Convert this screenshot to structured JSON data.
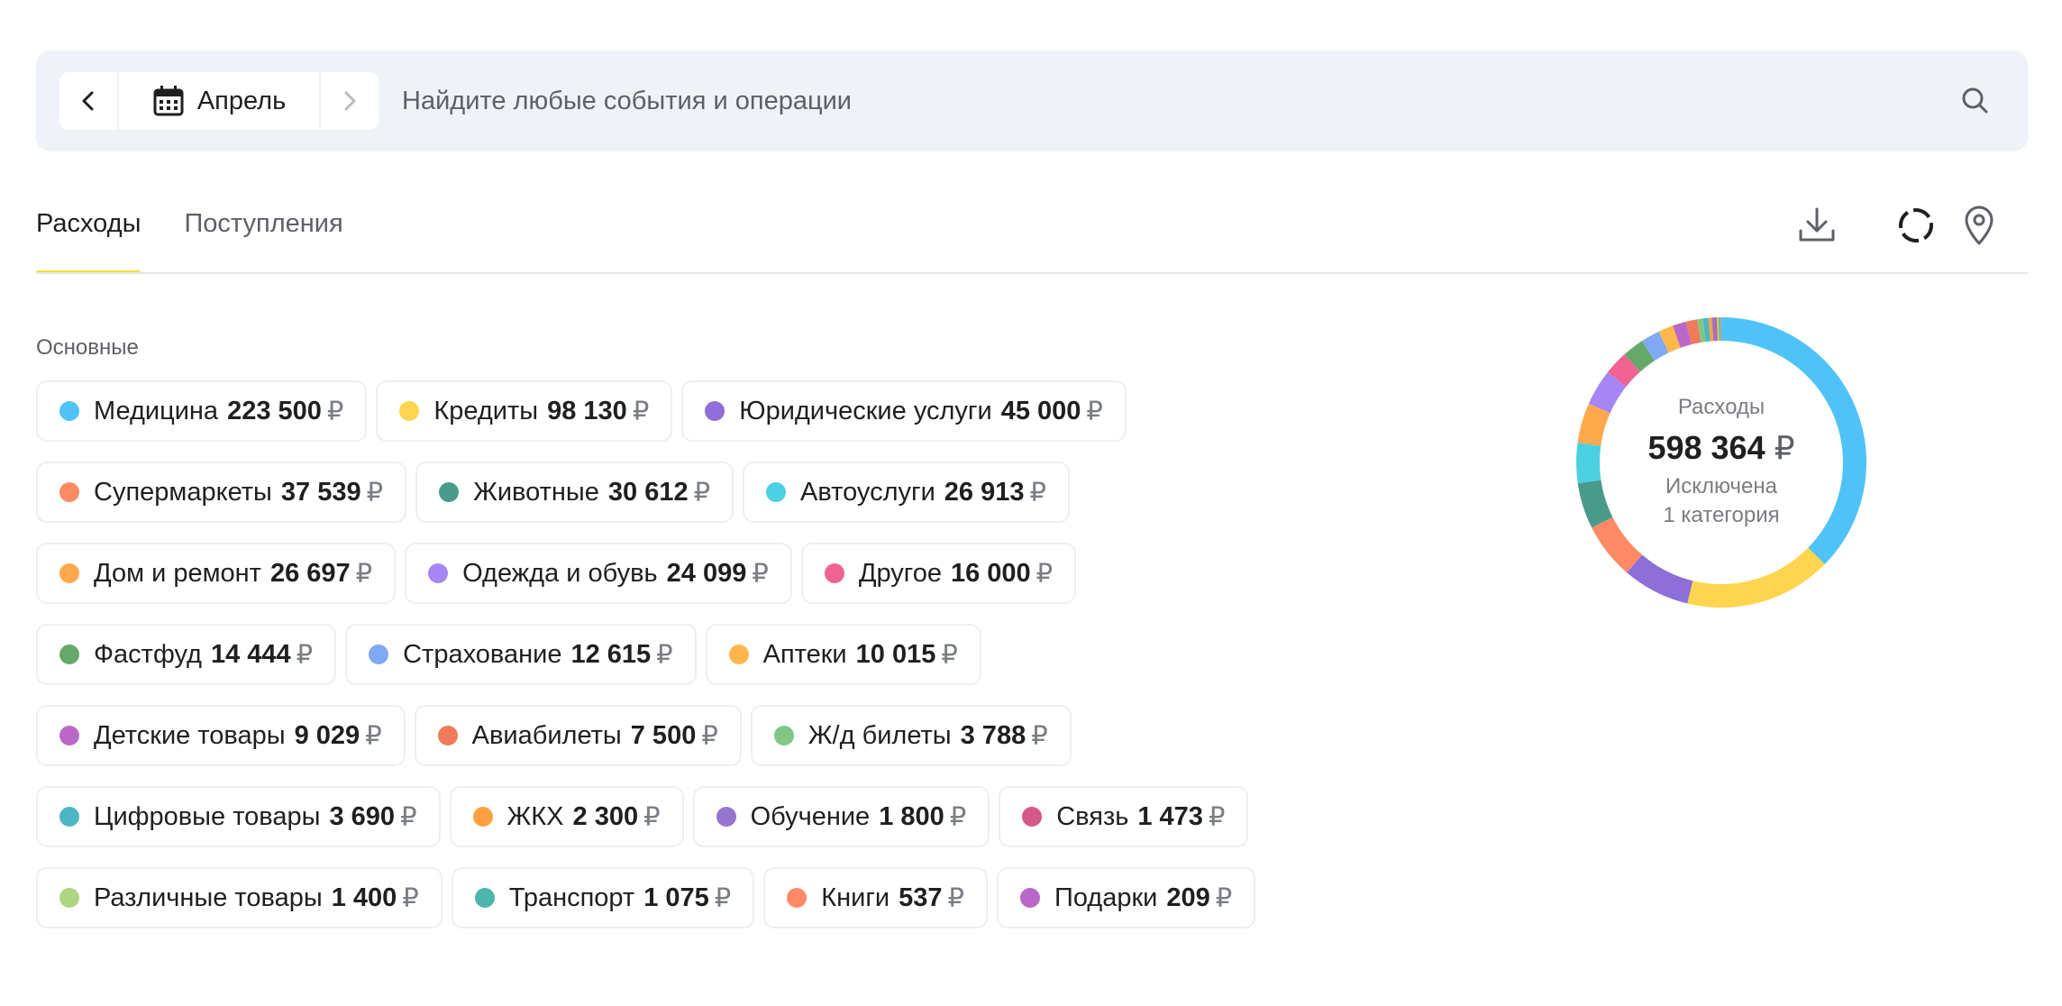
{
  "topbar": {
    "month": "Апрель",
    "search_placeholder": "Найдите любые события и операции"
  },
  "tabs": [
    {
      "label": "Расходы",
      "active": true
    },
    {
      "label": "Поступления",
      "active": false
    }
  ],
  "icons": {
    "prev": "chevron-left-icon",
    "next": "chevron-right-icon",
    "calendar": "calendar-icon",
    "search": "search-icon",
    "download": "download-icon",
    "chart_toggle": "donut-chart-icon",
    "location": "location-pin-icon"
  },
  "section_title": "Основные",
  "currency": "₽",
  "categories": [
    [
      {
        "name": "Медицина",
        "amount": "223 500",
        "value": 223500,
        "color": "#4fc3f7"
      },
      {
        "name": "Кредиты",
        "amount": "98 130",
        "value": 98130,
        "color": "#ffd54f"
      },
      {
        "name": "Юридические услуги",
        "amount": "45 000",
        "value": 45000,
        "color": "#8e6fd8"
      }
    ],
    [
      {
        "name": "Супермаркеты",
        "amount": "37 539",
        "value": 37539,
        "color": "#ff8a65"
      },
      {
        "name": "Животные",
        "amount": "30 612",
        "value": 30612,
        "color": "#4a9a8a"
      },
      {
        "name": "Автоуслуги",
        "amount": "26 913",
        "value": 26913,
        "color": "#4dd0e1"
      }
    ],
    [
      {
        "name": "Дом и ремонт",
        "amount": "26 697",
        "value": 26697,
        "color": "#ffa94d"
      },
      {
        "name": "Одежда и обувь",
        "amount": "24 099",
        "value": 24099,
        "color": "#a685f5"
      },
      {
        "name": "Другое",
        "amount": "16 000",
        "value": 16000,
        "color": "#f06292"
      }
    ],
    [
      {
        "name": "Фастфуд",
        "amount": "14 444",
        "value": 14444,
        "color": "#66a86a"
      },
      {
        "name": "Страхование",
        "amount": "12 615",
        "value": 12615,
        "color": "#7fa8f5"
      },
      {
        "name": "Аптеки",
        "amount": "10 015",
        "value": 10015,
        "color": "#ffb74d"
      }
    ],
    [
      {
        "name": "Детские товары",
        "amount": "9 029",
        "value": 9029,
        "color": "#ba68c8"
      },
      {
        "name": "Авиабилеты",
        "amount": "7 500",
        "value": 7500,
        "color": "#ef7b5a"
      },
      {
        "name": "Ж/д билеты",
        "amount": "3 788",
        "value": 3788,
        "color": "#81c784"
      }
    ],
    [
      {
        "name": "Цифровые товары",
        "amount": "3 690",
        "value": 3690,
        "color": "#4db6c4"
      },
      {
        "name": "ЖКХ",
        "amount": "2 300",
        "value": 2300,
        "color": "#ffa040"
      },
      {
        "name": "Обучение",
        "amount": "1 800",
        "value": 1800,
        "color": "#9575cd"
      },
      {
        "name": "Связь",
        "amount": "1 473",
        "value": 1473,
        "color": "#d6578a"
      }
    ],
    [
      {
        "name": "Различные товары",
        "amount": "1 400",
        "value": 1400,
        "color": "#aed581"
      },
      {
        "name": "Транспорт",
        "amount": "1 075",
        "value": 1075,
        "color": "#4db6ac"
      },
      {
        "name": "Книги",
        "amount": "537",
        "value": 537,
        "color": "#ff8a65"
      },
      {
        "name": "Подарки",
        "amount": "209",
        "value": 209,
        "color": "#ba68c8"
      }
    ]
  ],
  "summary": {
    "label": "Расходы",
    "total": "598 364",
    "note_line1": "Исключена",
    "note_line2": "1 категория"
  }
}
